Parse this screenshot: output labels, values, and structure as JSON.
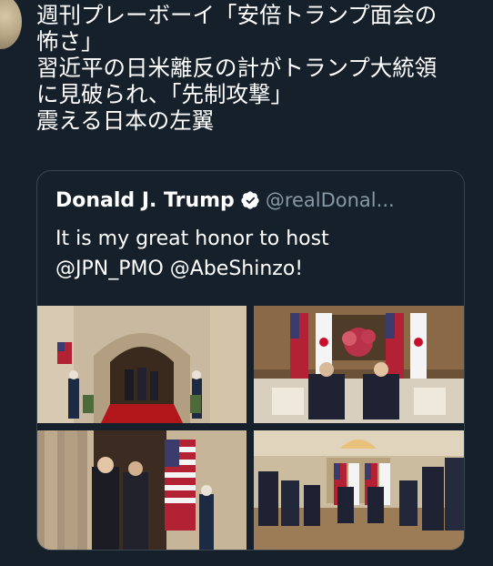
{
  "tweet": {
    "lines": [
      "週刊プレーボーイ「安倍トランプ面会の",
      "怖さ」",
      "習近平の日米離反の計がトランプ大統領",
      "に見破られ、「先制攻撃」",
      "震える日本の左翼"
    ]
  },
  "quoted_tweet": {
    "author_name": "Donald J. Trump",
    "author_handle": "@realDonal...",
    "text_lines": [
      "It is my great honor to host",
      "@JPN_PMO @AbeShinzo!"
    ],
    "verified_icon": "verified-badge-icon",
    "photos": [
      {
        "name": "entrance-photo",
        "description_icon": "photo-icon"
      },
      {
        "name": "handshake-seated-photo",
        "description_icon": "photo-icon"
      },
      {
        "name": "greeting-flag-photo",
        "description_icon": "photo-icon"
      },
      {
        "name": "meeting-room-photo",
        "description_icon": "photo-icon"
      }
    ]
  },
  "colors": {
    "background": "#15202b",
    "text": "#ffffff",
    "secondary_text": "#8899a6",
    "card_border": "#38444d"
  }
}
